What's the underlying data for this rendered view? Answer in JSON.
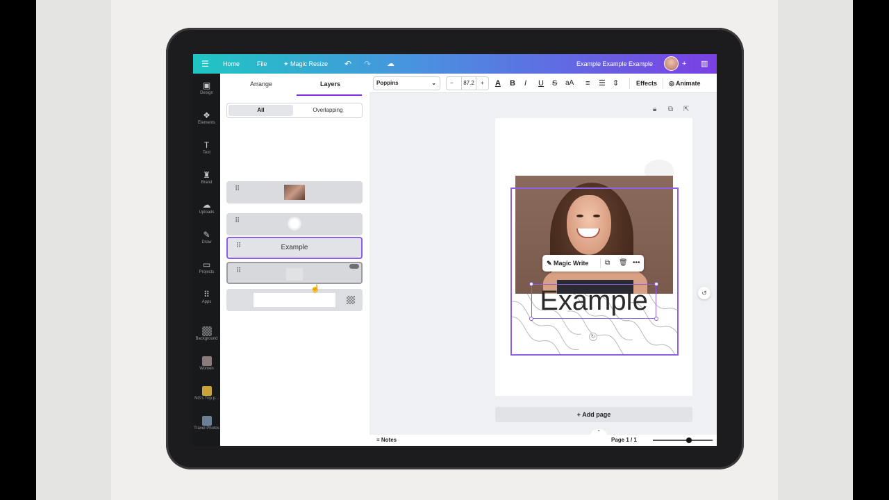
{
  "topbar": {
    "home": "Home",
    "file": "File",
    "magic_resize": "Magic Resize",
    "design_title": "Example Example Example",
    "menu_icon": "menu-icon",
    "undo_icon": "undo-icon",
    "redo_icon": "redo-icon",
    "cloud_icon": "cloud-check-icon"
  },
  "rail": {
    "items": [
      {
        "label": "Design",
        "icon": "design-icon"
      },
      {
        "label": "Elements",
        "icon": "elements-icon"
      },
      {
        "label": "Text",
        "icon": "text-icon"
      },
      {
        "label": "Brand",
        "icon": "brand-icon"
      },
      {
        "label": "Uploads",
        "icon": "uploads-icon"
      },
      {
        "label": "Draw",
        "icon": "draw-icon"
      },
      {
        "label": "Projects",
        "icon": "projects-icon"
      },
      {
        "label": "Apps",
        "icon": "apps-icon"
      },
      {
        "label": "Background",
        "icon": "background-icon"
      },
      {
        "label": "Women",
        "icon": "women-thumb"
      },
      {
        "label": "NG's Trip p...",
        "icon": "trip-thumb"
      },
      {
        "label": "Travel Photos",
        "icon": "travel-thumb"
      }
    ]
  },
  "panel": {
    "tabs": {
      "arrange": "Arrange",
      "layers": "Layers"
    },
    "filter": {
      "all": "All",
      "overlapping": "Overlapping"
    },
    "layers": [
      {
        "type": "image"
      },
      {
        "type": "shape"
      },
      {
        "type": "text",
        "label": "Example"
      },
      {
        "type": "group"
      },
      {
        "type": "background"
      }
    ]
  },
  "format_toolbar": {
    "font": "Poppins",
    "font_size": "87.2",
    "minus": "−",
    "plus": "+",
    "effects": "Effects",
    "animate": "Animate"
  },
  "canvas": {
    "text": "Example",
    "context_menu": {
      "magic_write": "Magic Write"
    }
  },
  "footer": {
    "add_page": "+ Add page",
    "notes": "Notes",
    "page": "Page 1 / 1"
  },
  "colors": {
    "accent": "#7d2ae8",
    "topbar_start": "#1fc6c3",
    "topbar_end": "#7b3fe4",
    "rail_bg": "#18191b"
  }
}
